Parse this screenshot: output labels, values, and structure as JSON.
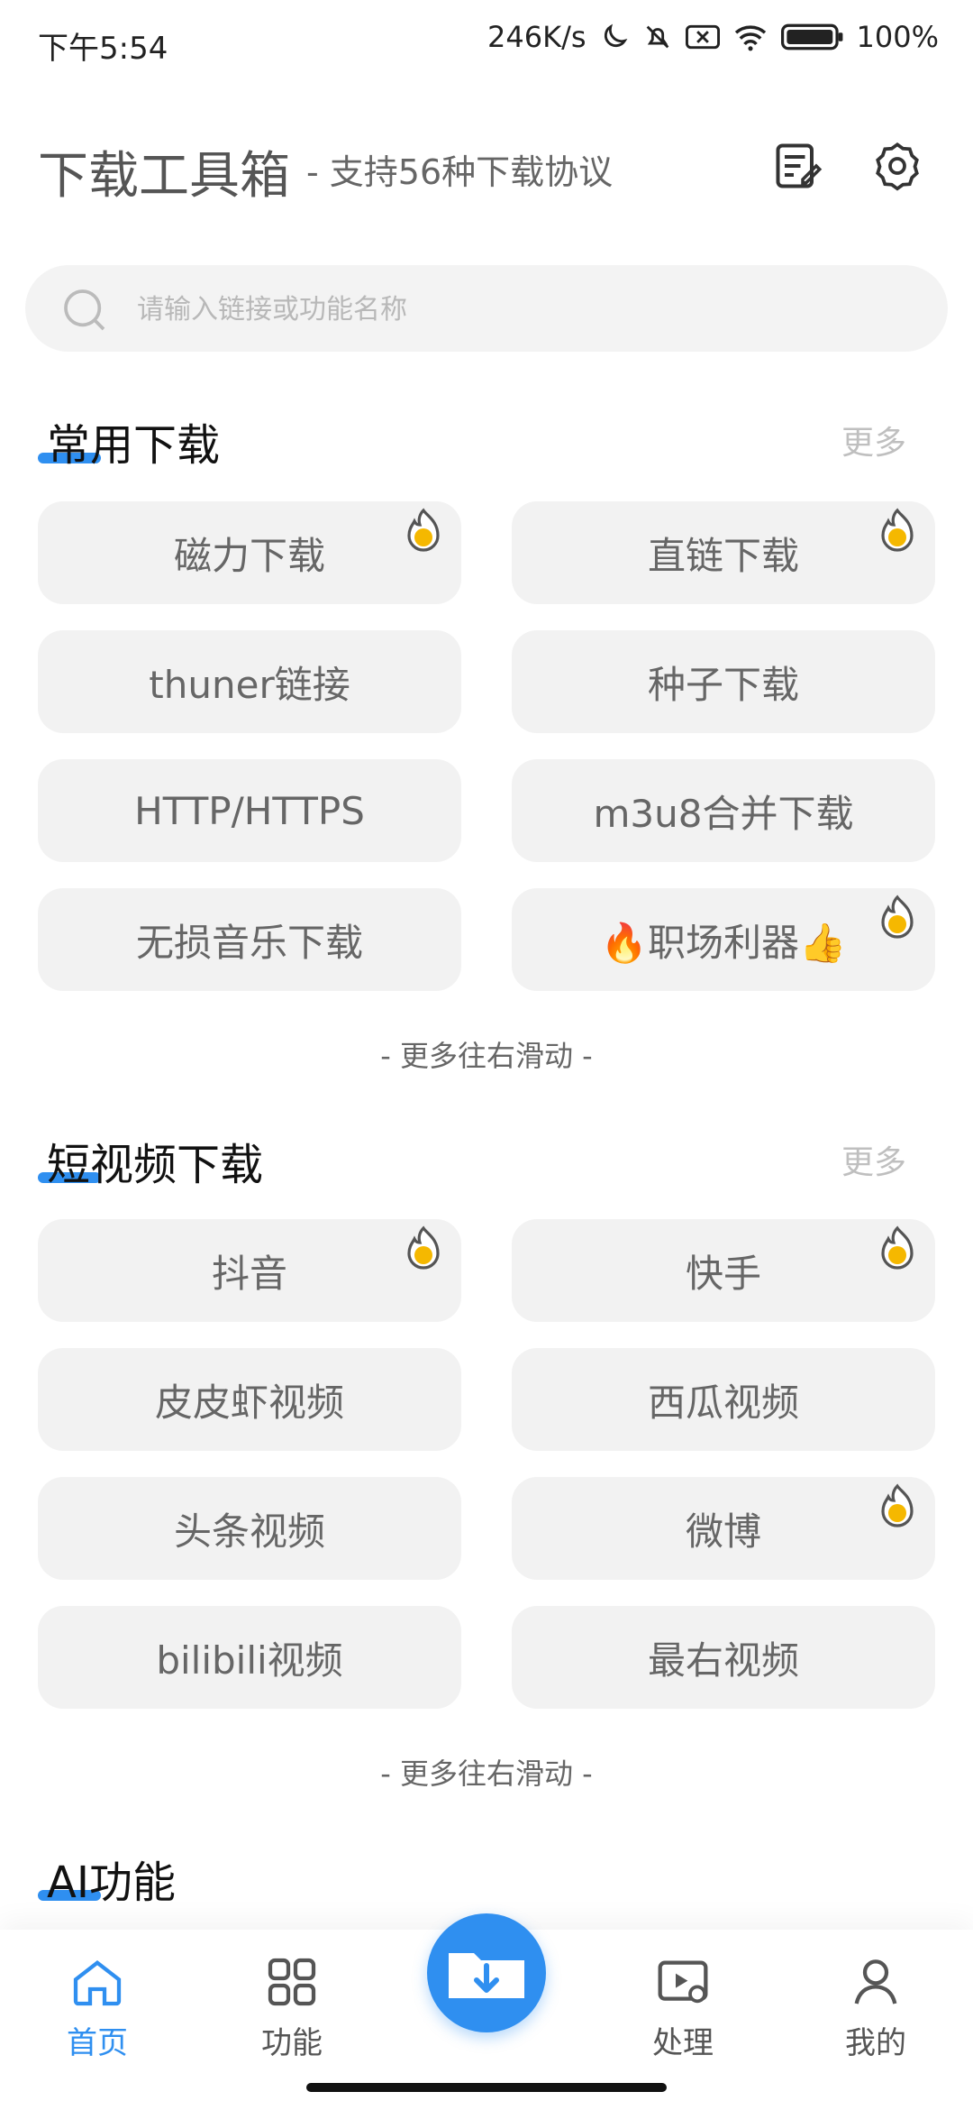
{
  "status": {
    "time": "下午5:54",
    "speed": "246K/s",
    "battery": "100%"
  },
  "header": {
    "title": "下载工具箱",
    "subtitle": "- 支持56种下载协议",
    "icons": [
      "edit-icon",
      "settings-icon"
    ]
  },
  "search": {
    "placeholder": "请输入链接或功能名称",
    "value": ""
  },
  "sections": [
    {
      "title": "常用下载",
      "more": "更多",
      "hint": "- 更多往右滑动 -",
      "items": [
        {
          "label": "磁力下载",
          "hot": true
        },
        {
          "label": "直链下载",
          "hot": true
        },
        {
          "label": "thuner链接",
          "hot": false
        },
        {
          "label": "种子下载",
          "hot": false
        },
        {
          "label": "HTTP/HTTPS",
          "hot": false
        },
        {
          "label": "m3u8合并下载",
          "hot": false
        },
        {
          "label": "无损音乐下载",
          "hot": false
        },
        {
          "label": "🔥职场利器👍",
          "hot": true
        }
      ]
    },
    {
      "title": "短视频下载",
      "more": "更多",
      "hint": "- 更多往右滑动 -",
      "items": [
        {
          "label": "抖音",
          "hot": true
        },
        {
          "label": "快手",
          "hot": true
        },
        {
          "label": "皮皮虾视频",
          "hot": false
        },
        {
          "label": "西瓜视频",
          "hot": false
        },
        {
          "label": "头条视频",
          "hot": false
        },
        {
          "label": "微博",
          "hot": true
        },
        {
          "label": "bilibili视频",
          "hot": false
        },
        {
          "label": "最右视频",
          "hot": false
        }
      ]
    },
    {
      "title": "AI功能"
    }
  ],
  "nav": {
    "items": [
      {
        "label": "首页",
        "icon": "home-icon",
        "active": true
      },
      {
        "label": "功能",
        "icon": "grid-icon",
        "active": false
      },
      {
        "label": "处理",
        "icon": "video-process-icon",
        "active": false
      },
      {
        "label": "我的",
        "icon": "user-icon",
        "active": false
      }
    ],
    "center_icon": "download-folder-icon"
  },
  "colors": {
    "accent": "#2f8ff0",
    "tile_bg": "#f2f2f2",
    "hot_badge": "#f5b800"
  }
}
